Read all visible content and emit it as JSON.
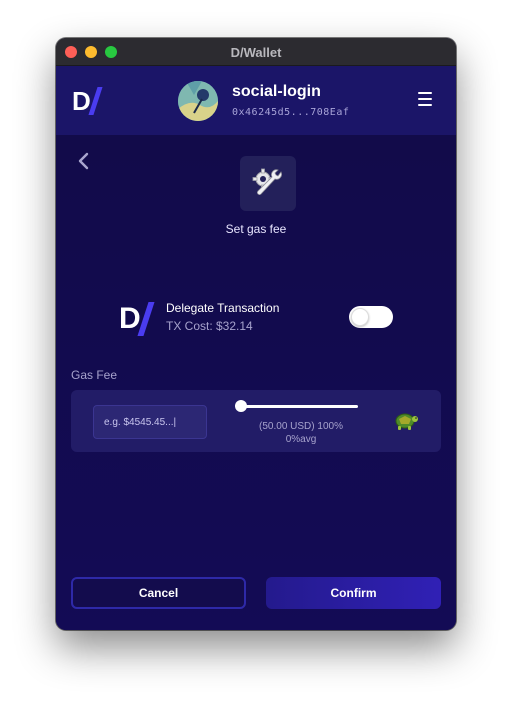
{
  "window": {
    "title": "D/Wallet"
  },
  "header": {
    "logo_letter": "D",
    "account_name": "social-login",
    "account_address": "0x46245d5...708Eaf"
  },
  "page": {
    "title": "Set gas fee"
  },
  "delegate": {
    "logo_letter": "D",
    "title": "Delegate Transaction",
    "cost": "TX Cost: $32.14",
    "enabled": false
  },
  "gas": {
    "label": "Gas Fee",
    "input_placeholder": "e.g. $4545.45...|",
    "slider_value_fraction": 0.0,
    "slider_line1": "(50.00 USD) 100%",
    "slider_line2": "0%avg",
    "speed_icon": "turtle-icon"
  },
  "actions": {
    "cancel_label": "Cancel",
    "confirm_label": "Confirm"
  },
  "colors": {
    "background": "#120b4a",
    "header": "#1b1568",
    "accent": "#4a3cf0",
    "panel": "#221c67"
  }
}
